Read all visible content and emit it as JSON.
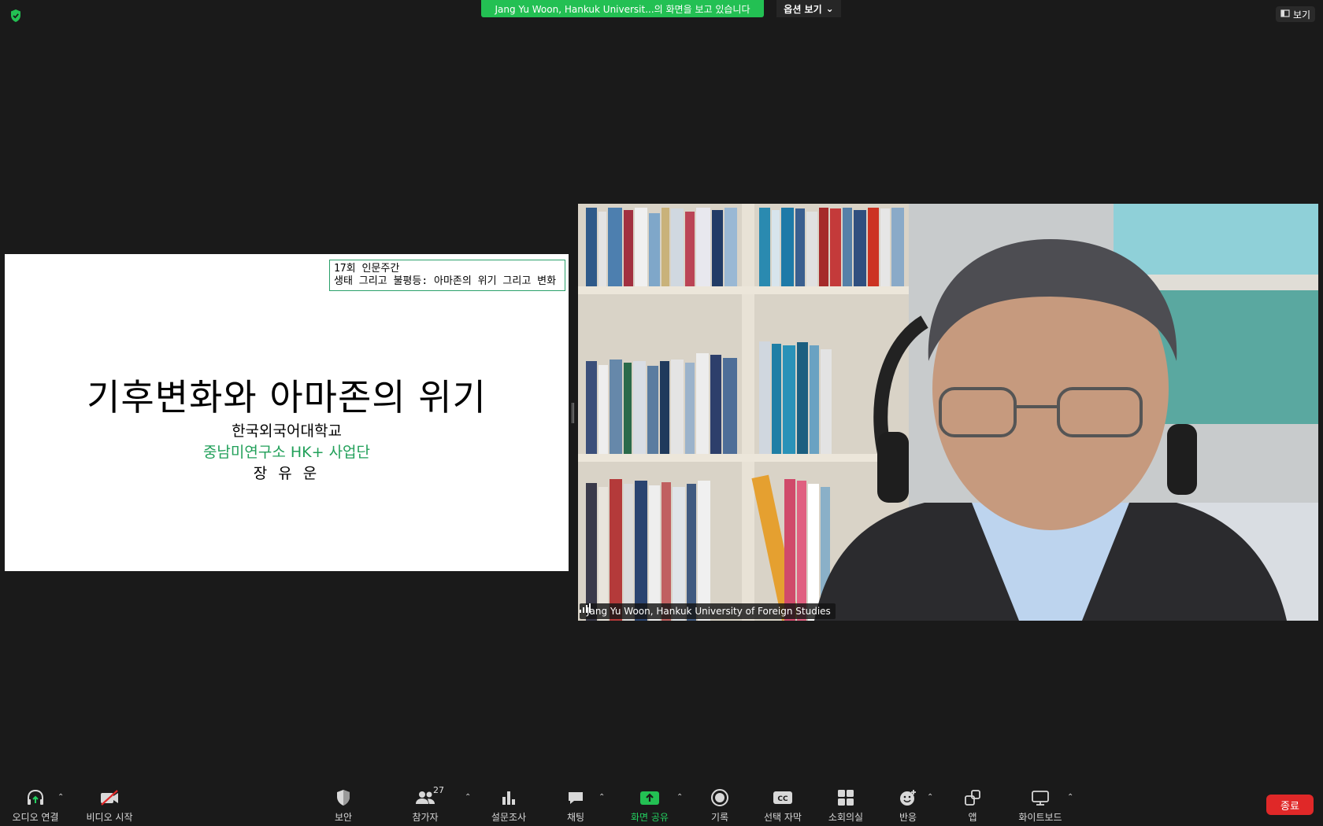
{
  "top": {
    "banner_text": "Jang Yu Woon, Hankuk Universit...의 화면을 보고 있습니다",
    "options_label": "옵션 보기",
    "view_label": "보기"
  },
  "slide": {
    "box_line1": "17회 인문주간",
    "box_line2": "생태 그리고 불평등: 아마존의 위기 그리고 변화",
    "title": "기후변화와 아마존의 위기",
    "line1": "한국외국어대학교",
    "line2": "중남미연구소 HK+ 사업단",
    "line3": "장 유 운"
  },
  "video": {
    "participant_name": "Jang Yu Woon, Hankuk University of Foreign Studies"
  },
  "toolbar": {
    "audio": "오디오 연결",
    "video": "비디오 시작",
    "security": "보안",
    "participants": "참가자",
    "participants_count": "27",
    "polls": "설문조사",
    "chat": "채팅",
    "share": "화면 공유",
    "record": "기록",
    "captions": "선택 자막",
    "breakout": "소회의실",
    "reactions": "반응",
    "apps": "앱",
    "whiteboard": "화이트보드",
    "end": "종료"
  },
  "colors": {
    "accent_green": "#23c053",
    "end_red": "#e02828",
    "background": "#1a1a1a"
  }
}
